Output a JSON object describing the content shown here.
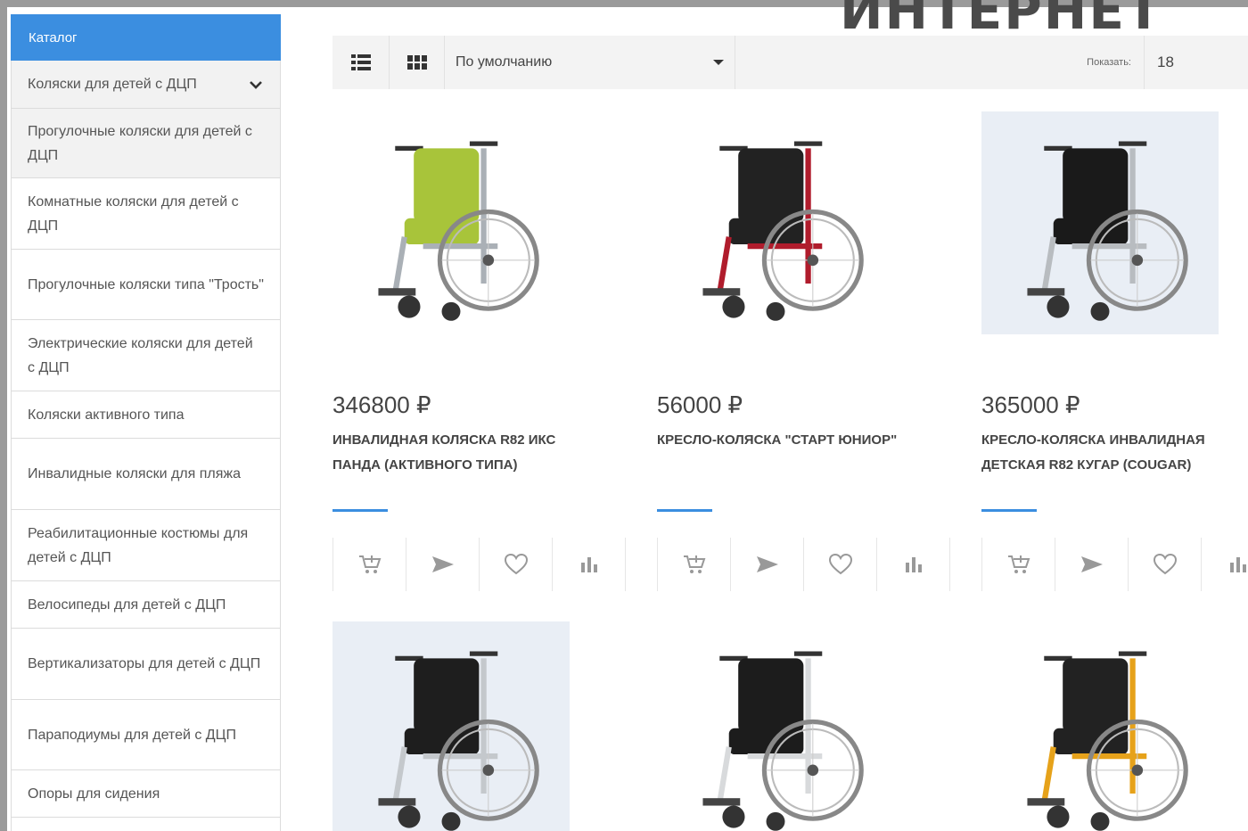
{
  "watermark": "ИНТЕРНЕТ",
  "sidebar": {
    "header": "Каталог",
    "items": [
      {
        "label": "Коляски для детей с ДЦП"
      },
      {
        "label": "Прогулочные коляски для детей с ДЦП"
      },
      {
        "label": "Комнатные коляски для детей с ДЦП"
      },
      {
        "label": "Прогулочные коляски типа \"Трость\""
      },
      {
        "label": "Электрические коляски для детей с ДЦП"
      },
      {
        "label": "Коляски активного типа"
      },
      {
        "label": "Инвалидные коляски для пляжа"
      },
      {
        "label": "Реабилитационные костюмы для детей с ДЦП"
      },
      {
        "label": "Велосипеды для детей с ДЦП"
      },
      {
        "label": "Вертикализаторы для детей с ДЦП"
      },
      {
        "label": "Параподиумы для детей с ДЦП"
      },
      {
        "label": "Опоры для сидения"
      }
    ]
  },
  "toolbar": {
    "sort_value": "По умолчанию",
    "show_label": "Показать:",
    "show_value": "18"
  },
  "products": [
    {
      "price": "346800 ₽",
      "title": "Инвалидная коляска R82 Икс Панда (активного типа)",
      "frame_color": "#aab0b6",
      "seat_color": "#a8c43a"
    },
    {
      "price": "56000 ₽",
      "title": "Кресло-коляска \"Старт Юниор\"",
      "frame_color": "#b01c2c",
      "seat_color": "#222222"
    },
    {
      "price": "365000 ₽",
      "title": "Кресло-коляска инвалидная детская R82 Кугар (Cougar)",
      "frame_color": "#b8bcc0",
      "seat_color": "#1a1a1a"
    },
    {
      "frame_color": "#c4c8cc",
      "seat_color": "#1e1e1e"
    },
    {
      "frame_color": "#d8dadc",
      "seat_color": "#1c1c1c"
    },
    {
      "frame_color": "#e6a21a",
      "seat_color": "#222222"
    }
  ],
  "colors": {
    "accent": "#3b8ee0",
    "toolbar_bg": "#f3f3f3"
  }
}
